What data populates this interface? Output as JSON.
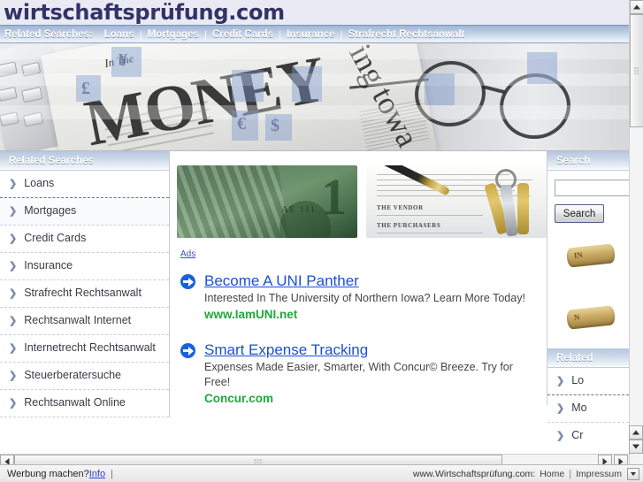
{
  "site": {
    "title": "wirtschaftsprüfung.com"
  },
  "topnav": {
    "label": "Related Searches:",
    "items": [
      {
        "label": "Loans"
      },
      {
        "label": "Mortgages"
      },
      {
        "label": "Credit Cards"
      },
      {
        "label": "Insurance"
      },
      {
        "label": "Strafrecht Rechtsanwalt"
      }
    ],
    "separator": "|"
  },
  "hero": {
    "newspaper_headline": "MONEY",
    "newspaper_kicker": "In The",
    "newspaper_text": "ing towa",
    "alt": "financial banner with calculator, newspaper and eyeglasses",
    "symbols": [
      "£",
      "$",
      "€",
      "¥"
    ]
  },
  "sidebar": {
    "heading": "Related Searches",
    "items": [
      {
        "label": "Loans"
      },
      {
        "label": "Mortgages"
      },
      {
        "label": "Credit Cards"
      },
      {
        "label": "Insurance"
      },
      {
        "label": "Strafrecht Rechtsanwalt"
      },
      {
        "label": "Rechtsanwalt Internet"
      },
      {
        "label": "Internetrecht Rechtsanwalt"
      },
      {
        "label": "Steuerberatersuche"
      },
      {
        "label": "Rechtsanwalt Online"
      }
    ],
    "chevron": "❯"
  },
  "main": {
    "images": [
      {
        "name": "dollar-bills-image",
        "caption_text": "AE 111",
        "big_digit": "1"
      },
      {
        "name": "contract-keys-image",
        "line1": "THE VENDOR",
        "line2": "THE PURCHASERS"
      }
    ],
    "ads_label": "Ads",
    "ads": [
      {
        "title": "Become A UNI Panther",
        "description": "Interested In The University of Northern Iowa? Learn More Today!",
        "url": "www.IamUNI.net"
      },
      {
        "title": "Smart Expense Tracking",
        "description": "Expenses Made Easier, Smarter, With Concur© Breeze. Try for Free!",
        "url": "Concur.com"
      }
    ]
  },
  "right_panel": {
    "search_heading": "Search",
    "search_value": "",
    "search_placeholder": "",
    "search_button": "Search",
    "related_heading": "Related",
    "related_items": [
      {
        "label": "Lo"
      },
      {
        "label": "Mo"
      },
      {
        "label": "Cr"
      }
    ]
  },
  "footer": {
    "left_text": "Werbung machen?",
    "left_link": "Info",
    "pipe": "|",
    "domain": "www.Wirtschaftsprüfung.com:",
    "links": [
      {
        "label": "Home"
      },
      {
        "label": "Impressum"
      }
    ],
    "separator": "|"
  },
  "colors": {
    "title": "#333366",
    "nav_gradient_start": "#9fb4d4",
    "ad_title": "#1a4fd6",
    "ad_url": "#1fa83c",
    "bullet": "#1863dc",
    "link": "#2b3fc9"
  }
}
